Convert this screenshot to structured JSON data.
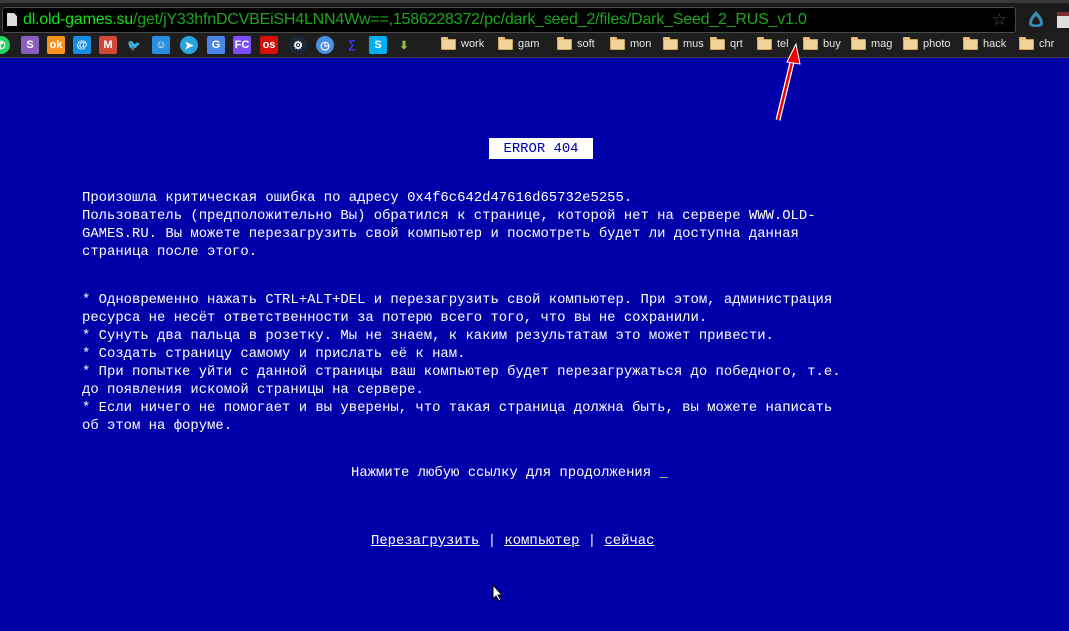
{
  "browser": {
    "url_host": "dl.old-games.su",
    "url_path": "/get/jY33hfnDCVBEiSH4LNN4Ww==,1586228372/pc/dark_seed_2/files/Dark_Seed_2_RUS_v1.0",
    "bookmark_icons": [
      {
        "name": "whatsapp",
        "glyph": "✆",
        "color": "#25d366"
      },
      {
        "name": "s-app",
        "glyph": "S",
        "color": "#8b5fbf"
      },
      {
        "name": "odnoklassniki",
        "glyph": "ok",
        "color": "#f7931e"
      },
      {
        "name": "mail-at",
        "glyph": "@",
        "color": "#168de2"
      },
      {
        "name": "gmail",
        "glyph": "M",
        "color": "#d44638"
      },
      {
        "name": "twitter",
        "glyph": "🐦",
        "color": "#1da1f2"
      },
      {
        "name": "smile-app",
        "glyph": "☺",
        "color": "#2a8ee0"
      },
      {
        "name": "telegram",
        "glyph": "➤",
        "color": "#2aa3df"
      },
      {
        "name": "google-translate",
        "glyph": "G",
        "color": "#4a86e8"
      },
      {
        "name": "fc-app",
        "glyph": "FC",
        "color": "#7c4dff"
      },
      {
        "name": "lastfm",
        "glyph": "os",
        "color": "#d51007"
      },
      {
        "name": "steam",
        "glyph": "⚙",
        "color": "#1b2838"
      },
      {
        "name": "clock",
        "glyph": "◷",
        "color": "#4a90e2"
      },
      {
        "name": "sigma",
        "glyph": "∑",
        "color": "#3a3aff"
      },
      {
        "name": "skype",
        "glyph": "S",
        "color": "#00aff0"
      },
      {
        "name": "download",
        "glyph": "⬇",
        "color": "#8bc34a"
      }
    ],
    "bookmark_folders": [
      "work",
      "gam",
      "soft",
      "mon",
      "mus",
      "qrt",
      "tel",
      "buy",
      "mag",
      "photo",
      "hack",
      "chr"
    ]
  },
  "page": {
    "error_title": "ERROR 404",
    "paragraph1": "Произошла критическая ошибка по адресу 0x4f6c642d47616d65732e5255.\nПользователь (предположительно Вы) обратился к странице, которой нет на сервере WWW.OLD-\nGAMES.RU. Вы можете перезагрузить свой компьютер и посмотреть будет ли доступна данная\nстраница после этого.",
    "paragraph2": "* Одновременно нажать CTRL+ALT+DEL и перезагрузить свой компьютер. При этом, администрация\nресурса не несёт ответственности за потерю всего того, что вы не сохранили.\n* Сунуть два пальца в розетку. Мы не знаем, к каким результатам это может привести.\n* Создать страницу самому и прислать её к нам.\n* При попытке уйти с данной страницы ваш компьютер будет перезагружаться до победного, т.е.\nдо появления искомой страницы на сервере.\n* Если ничего не помогает и вы уверены, что такая страница должна быть, вы можете написать\nоб этом на форуме.",
    "prompt": "Нажмите любую ссылку для продолжения ",
    "cursor": "_",
    "links": [
      "Перезагрузить",
      "компьютер",
      "сейчас"
    ],
    "separator": " | "
  },
  "colors": {
    "background": "#0000aa",
    "text": "#ffffff",
    "cursor": "#ffff55",
    "url_host": "#19e019",
    "url_path": "#1da51d"
  }
}
